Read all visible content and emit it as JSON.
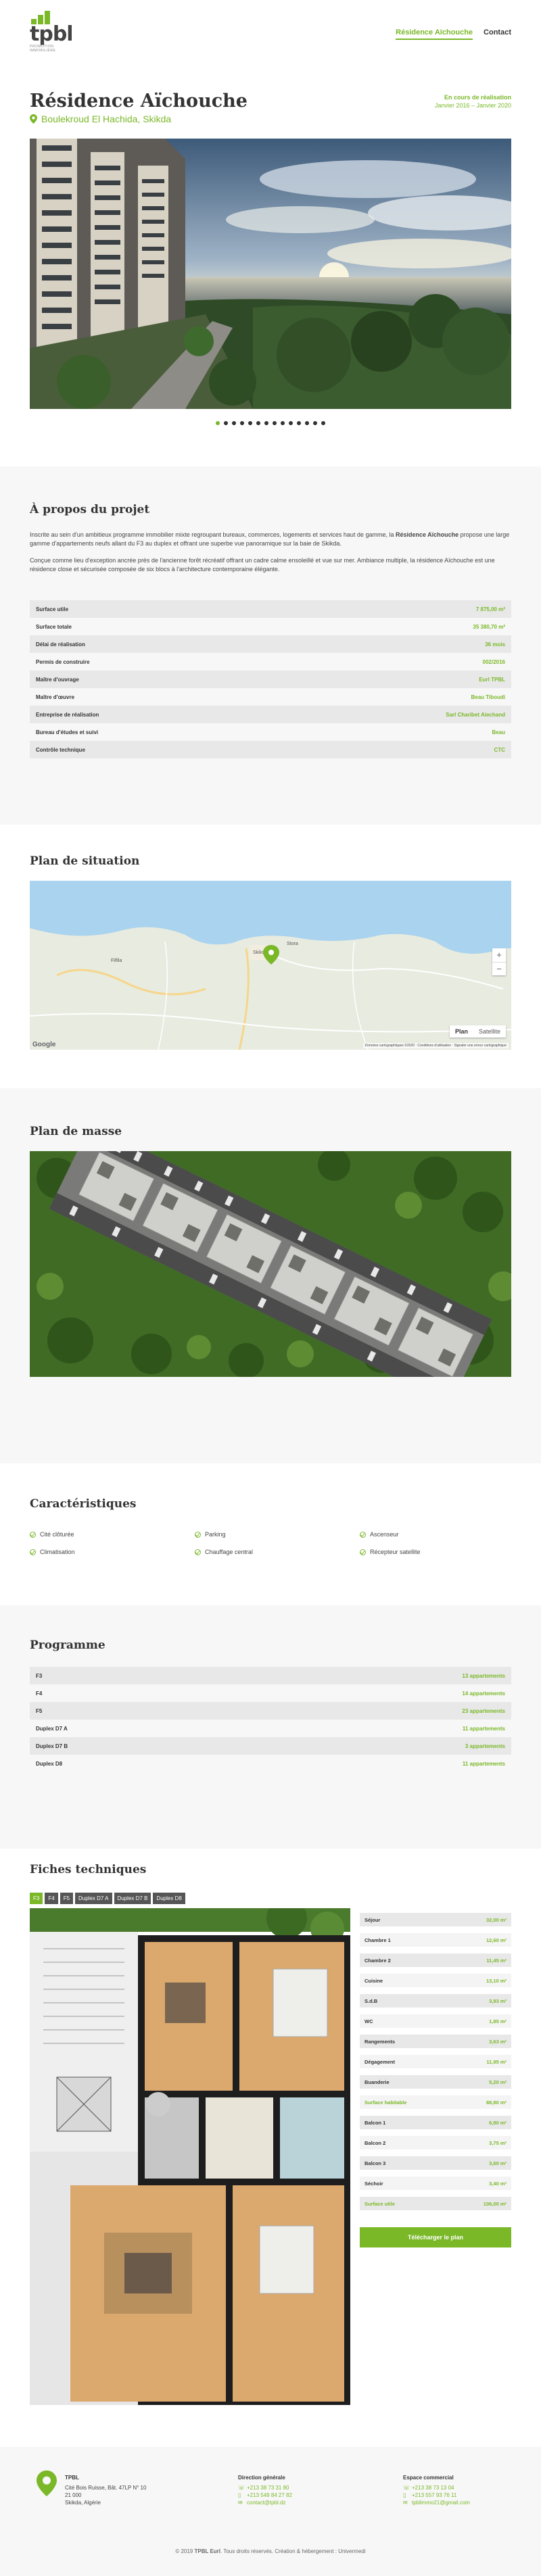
{
  "brand": {
    "logo": "tpbl",
    "tagline": "PROMOTION IMMOBILIÈRE",
    "accent": "#7ab828"
  },
  "nav": {
    "items": [
      {
        "label": "Résidence Aïchouche"
      },
      {
        "label": "Contact"
      }
    ]
  },
  "project": {
    "title": "Résidence Aïchouche",
    "address": "Boulekroud El Hachida, Skikda",
    "status": "En cours de réalisation",
    "period": "Janvier 2016 – Janvier 2020",
    "carousel_count": 14,
    "carousel_active": 0
  },
  "about": {
    "title": "À propos du projet",
    "paragraph1_a": "Inscrite au sein d'un ambitieux programme immobilier mixte regroupant bureaux, commerces, logements et services haut de gamme, la ",
    "paragraph1_b": "Résidence Aïchouche",
    "paragraph1_c": " propose une large gamme d'appartements neufs allant du F3 au duplex et offrant une superbe vue panoramique sur la baie de Skikda.",
    "paragraph2": "Conçue comme lieu d'exception ancrée près de l'ancienne forêt récréatif offrant un cadre calme ensoleillé et vue sur mer. Ambiance multiple, la résidence Aïchouche est une résidence close et sécurisée composée de six blocs à l'architecture contemporaine élégante.",
    "rows": [
      {
        "label": "Surface utile",
        "value": "7 875,00 m²"
      },
      {
        "label": "Surface totale",
        "value": "35 380,70 m²"
      },
      {
        "label": "Délai de réalisation",
        "value": "36 mois"
      },
      {
        "label": "Permis de construire",
        "value": "002/2016"
      },
      {
        "label": "Maître d'ouvrage",
        "value": "Eurl TPBL"
      },
      {
        "label": "Maître d'œuvre",
        "value": "Beau Tiboudi"
      },
      {
        "label": "Entreprise de réalisation",
        "value": "Sarl Charibet Aiechand"
      },
      {
        "label": "Bureau d'études et suivi",
        "value": "Beau"
      },
      {
        "label": "Contrôle technique",
        "value": "CTC"
      }
    ]
  },
  "situation": {
    "title": "Plan de situation",
    "map_type_plan": "Plan",
    "map_type_sat": "Satellite",
    "zoom_in": "+",
    "zoom_out": "−",
    "attribution": "Données cartographiques ©2020 · Conditions d'utilisation · Signaler une erreur cartographique",
    "google": "Google",
    "labels": [
      "Skikda",
      "Filfila",
      "Stora"
    ]
  },
  "masse": {
    "title": "Plan de masse"
  },
  "features": {
    "title": "Caractéristiques",
    "items": [
      "Cité clôturée",
      "Parking",
      "Ascenseur",
      "Climatisation",
      "Chauffage central",
      "Récepteur satellite"
    ]
  },
  "programme": {
    "title": "Programme",
    "rows": [
      {
        "label": "F3",
        "value": "13 appartements"
      },
      {
        "label": "F4",
        "value": "14 appartements"
      },
      {
        "label": "F5",
        "value": "23 appartements"
      },
      {
        "label": "Duplex D7 A",
        "value": "11 appartements"
      },
      {
        "label": "Duplex D7 B",
        "value": "3 appartements"
      },
      {
        "label": "Duplex D8",
        "value": "11 appartements"
      }
    ]
  },
  "fiches": {
    "title": "Fiches techniques",
    "tabs": [
      "F3",
      "F4",
      "F5",
      "Duplex D7 A",
      "Duplex D7 B",
      "Duplex D8"
    ],
    "active_tab": 0,
    "rows": [
      {
        "label": "Séjour",
        "value": "32,00 m²"
      },
      {
        "label": "Chambre 1",
        "value": "12,60 m²"
      },
      {
        "label": "Chambre 2",
        "value": "11,45 m²"
      },
      {
        "label": "Cuisine",
        "value": "13,10 m²"
      },
      {
        "label": "S.d.B",
        "value": "3,93 m²"
      },
      {
        "label": "WC",
        "value": "1,85 m²"
      },
      {
        "label": "Rangements",
        "value": "3,63 m²"
      },
      {
        "label": "Dégagement",
        "value": "11,95 m²"
      },
      {
        "label": "Buanderie",
        "value": "5,20 m²"
      },
      {
        "label": "Surface habitable",
        "value": "88,80 m²",
        "highlight": true
      },
      {
        "label": "Balcon 1",
        "value": "6,80 m²"
      },
      {
        "label": "Balcon 2",
        "value": "3,75 m²"
      },
      {
        "label": "Balcon 3",
        "value": "3,60 m²"
      },
      {
        "label": "Séchoir",
        "value": "3,40 m²"
      },
      {
        "label": "Surface utile",
        "value": "106,00 m²",
        "highlight": true
      }
    ],
    "download": "Télécharger le plan"
  },
  "footer": {
    "company": "TPBL",
    "addr1": "Cité Bois Ruisse, Bât. 47LP N° 10",
    "addr2": "21 000",
    "addr3": "Skikda, Algérie",
    "direction_title": "Direction générale",
    "direction": [
      "+213 38 73 31 80",
      "+213 549 84 27 82",
      "contact@tpbl.dz"
    ],
    "commercial_title": "Espace commercial",
    "commercial": [
      "+213 38 73 13 04",
      "+213 557 93 76 11",
      "tpblimmo21@gmail.com"
    ],
    "copyright_a": "© 2019 ",
    "copyright_b": "TPBL Eurl",
    "copyright_c": ". Tous droits réservés. Création & hébergement : Univermedi"
  }
}
